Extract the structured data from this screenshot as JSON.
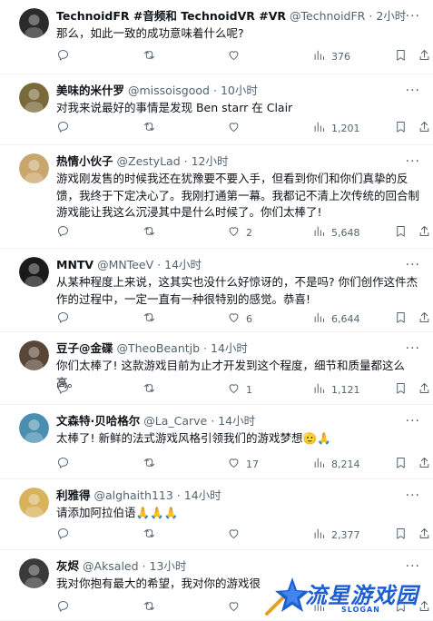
{
  "tweets": [
    {
      "name": "TechnoidFR #音频和 TechnoidVR #VR",
      "handle": "@TechnoidFR",
      "time": "2小时",
      "text": "那么，如此一致的成功意味着什么呢?",
      "reply_count": "",
      "retweet_count": "",
      "like_count": "",
      "views": "376",
      "avatar_color": "#2b2b2b"
    },
    {
      "name": "美味的米什罗",
      "handle": "@missoisgood",
      "time": "10小时",
      "text": "对我来说最好的事情是发现 Ben starr 在 Clair",
      "reply_count": "",
      "retweet_count": "",
      "like_count": "",
      "views": "1,201",
      "avatar_color": "#7a6a3a"
    },
    {
      "name": "热情小伙子",
      "handle": "@ZestyLad",
      "time": "12小时",
      "text": "游戏刚发售的时候我还在犹豫要不要入手，但看到你们和你们真挚的反馈，我终于下定决心了。我刚打通第一幕。我都记不清上次传统的回合制游戏能让我这么沉浸其中是什么时候了。你们太棒了!",
      "reply_count": "",
      "retweet_count": "",
      "like_count": "2",
      "views": "5,648",
      "avatar_color": "#c9a66b"
    },
    {
      "name": "MNTV",
      "handle": "@MNTeeV",
      "time": "14小时",
      "text": "从某种程度上来说，这其实也没什么好惊讶的，不是吗? 你们创作这件杰作的过程中，一定一直有一种很特别的感觉。恭喜!",
      "reply_count": "",
      "retweet_count": "",
      "like_count": "6",
      "views": "6,644",
      "avatar_color": "#1a1a1a"
    },
    {
      "name": "豆子@金碟",
      "handle": "@TheoBeantjb",
      "time": "14小时",
      "text": "你们太棒了! 这款游戏目前为止才开发到这个程度，细节和质量都这么高。",
      "reply_count": "",
      "retweet_count": "",
      "like_count": "1",
      "views": "1,121",
      "avatar_color": "#5a4636"
    },
    {
      "name": "文森特·贝哈格尔",
      "handle": "@La_Carve",
      "time": "14小时",
      "text": "太棒了! 新鲜的法式游戏风格引领我们的游戏梦想🫡🙏",
      "reply_count": "",
      "retweet_count": "",
      "like_count": "17",
      "views": "8,214",
      "avatar_color": "#4a8fb0"
    },
    {
      "name": "利雅得",
      "handle": "@alghaith113",
      "time": "14小时",
      "text": "请添加阿拉伯语🙏🙏🙏",
      "reply_count": "",
      "retweet_count": "",
      "like_count": "",
      "views": "2,377",
      "avatar_color": "#d9b25c"
    },
    {
      "name": "灰烬",
      "handle": "@Aksaled",
      "time": "13小时",
      "text": "我对你抱有最大的希望，我对你的游戏很",
      "reply_count": "",
      "retweet_count": "",
      "like_count": "",
      "views": "",
      "avatar_color": "#3a3a3a"
    }
  ],
  "watermark": {
    "title": "流星游戏园",
    "slogan": "SLOGAN",
    "color": "#1d5fd1"
  },
  "icons": {
    "reply": "reply-icon",
    "retweet": "retweet-icon",
    "like": "heart-icon",
    "views": "views-icon",
    "bookmark": "bookmark-icon",
    "share": "share-icon",
    "more": "more-icon"
  }
}
